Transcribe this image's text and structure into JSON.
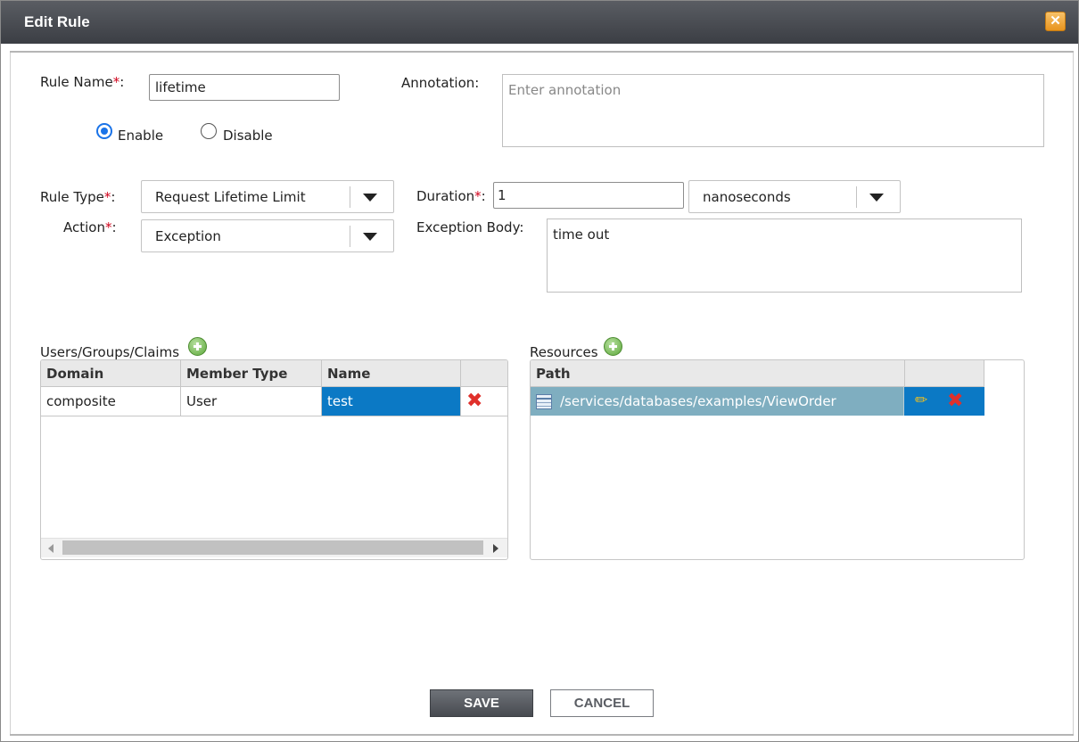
{
  "dialog": {
    "title": "Edit Rule",
    "close_glyph": "✕"
  },
  "rule_name": {
    "label": "Rule Name",
    "required": "*",
    "colon": ":",
    "value": "lifetime"
  },
  "status": {
    "enable_label": "Enable",
    "disable_label": "Disable",
    "selected": "Enable"
  },
  "annotation": {
    "label": "Annotation:",
    "placeholder": "Enter annotation"
  },
  "rule_type": {
    "label": "Rule Type",
    "required": "*",
    "colon": ":",
    "value": "Request Lifetime Limit"
  },
  "duration": {
    "label": "Duration",
    "required": "*",
    "colon": ":",
    "value": "1",
    "unit": "nanoseconds"
  },
  "action": {
    "label": "Action",
    "required": "*",
    "colon": ":",
    "value": "Exception"
  },
  "exception_body": {
    "label": "Exception Body:",
    "value": "time out"
  },
  "members": {
    "title": "Users/Groups/Claims",
    "columns": [
      "Domain",
      "Member Type",
      "Name"
    ],
    "rows": [
      {
        "domain": "composite",
        "member_type": "User",
        "name": "test"
      }
    ]
  },
  "resources": {
    "title": "Resources",
    "columns": [
      "Path"
    ],
    "rows": [
      {
        "path": "/services/databases/examples/ViewOrder"
      }
    ]
  },
  "buttons": {
    "save": "SAVE",
    "cancel": "CANCEL"
  },
  "icons": {
    "add": "add-circle-icon",
    "delete": "delete-x-icon",
    "edit": "pencil-icon",
    "dropdown": "chevron-down-icon",
    "table": "table-icon"
  },
  "colors": {
    "selection": "#0b79c5",
    "required": "#d0021b",
    "title_bar": "#3b3e44",
    "close_button": "#e8941e"
  }
}
